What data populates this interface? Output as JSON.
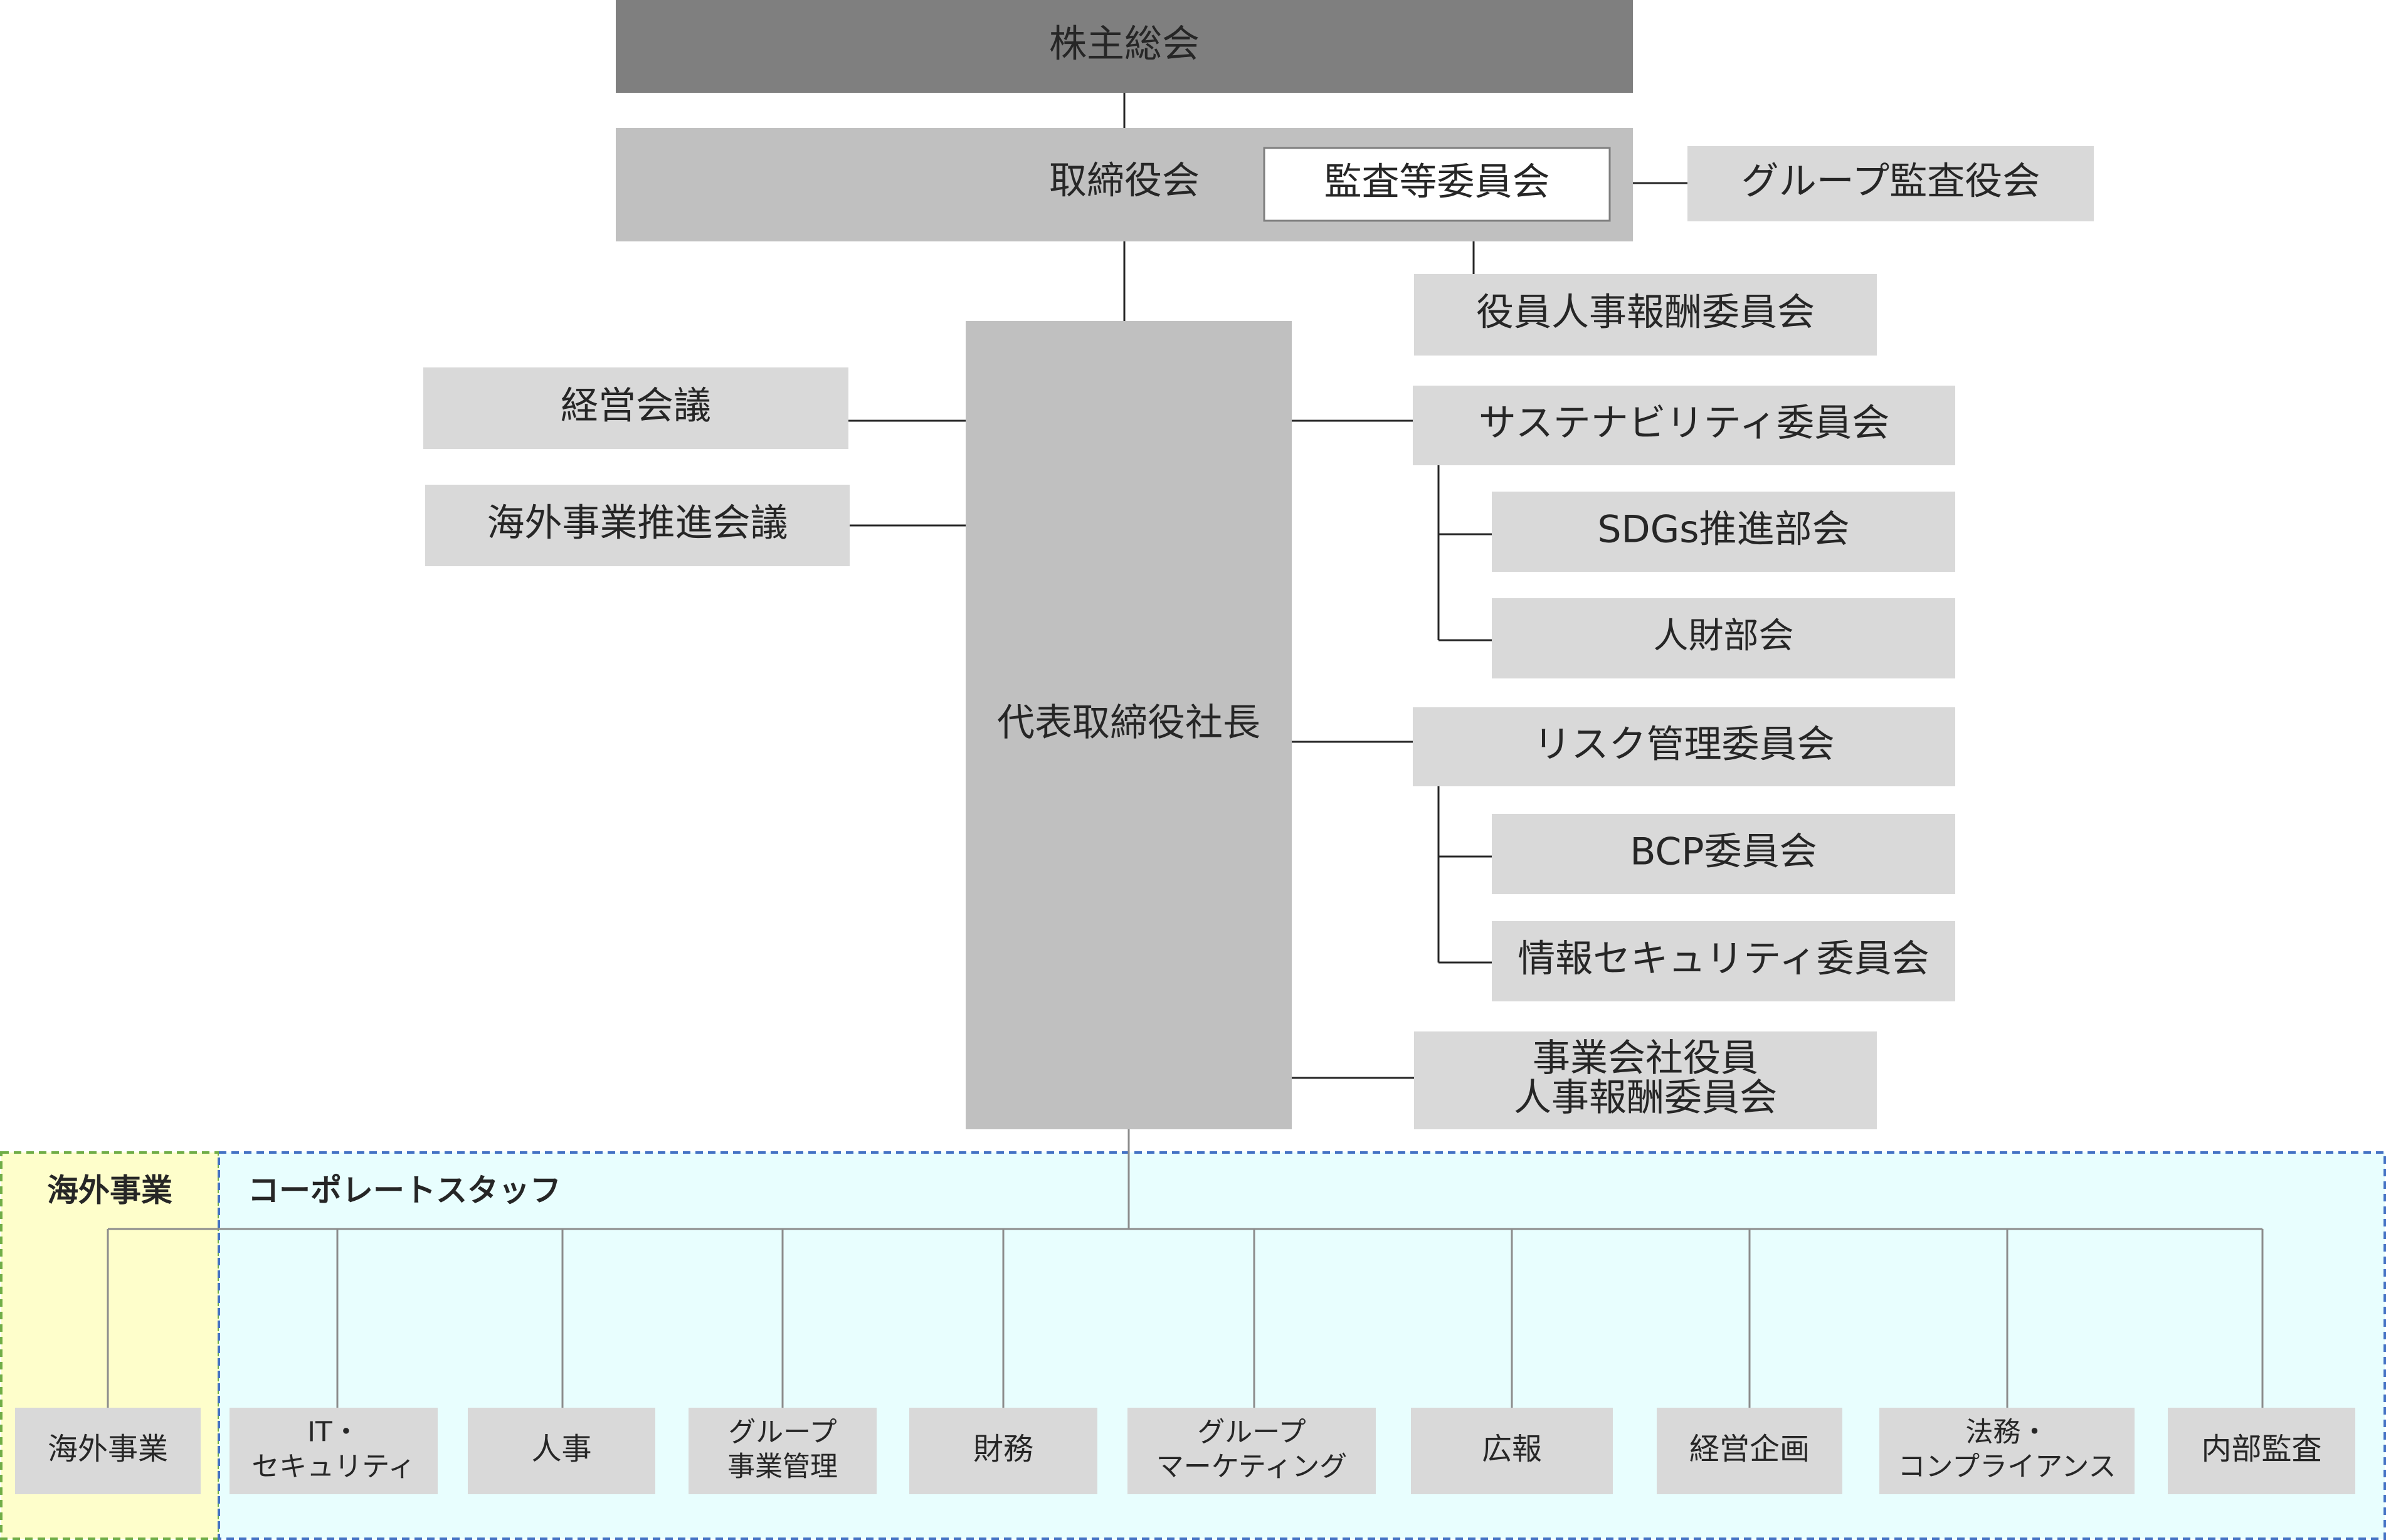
{
  "colors": {
    "dark_box": "#7f7f7f",
    "light_box": "#c0c0c0",
    "pale_box": "#d9d9d9",
    "line": "#262626",
    "staff_line": "#8c8c8c",
    "overseas_fill": "#fefecb",
    "overseas_border": "#70ad47",
    "overseas_label": "#548235",
    "corporate_fill": "#e8fefe",
    "corporate_border": "#4472c4",
    "corporate_label": "#2e75b6"
  },
  "governance": {
    "shareholders": "株主総会",
    "board": "取締役会",
    "audit_committee": "監査等委員会",
    "group_audit": "グループ監査役会",
    "officer_comp": "役員人事報酬委員会",
    "president": "代表取締役社長"
  },
  "left_meetings": [
    "経営会議",
    "海外事業推進会議"
  ],
  "committees": {
    "sustainability": "サステナビリティ委員会",
    "sdgs": "SDGs推進部会",
    "hr_sub": "人財部会",
    "risk": "リスク管理委員会",
    "bcp": "BCP委員会",
    "infosec": "情報セキュリティ委員会",
    "subsidiary_comp": [
      "事業会社役員",
      "人事報酬委員会"
    ]
  },
  "regions": {
    "overseas_label": "海外事業",
    "corporate_label": "コーポレートスタッフ"
  },
  "departments": [
    [
      "海外事業"
    ],
    [
      "IT・",
      "セキュリティ"
    ],
    [
      "人事"
    ],
    [
      "グループ",
      "事業管理"
    ],
    [
      "財務"
    ],
    [
      "グループ",
      "マーケティング"
    ],
    [
      "広報"
    ],
    [
      "経営企画"
    ],
    [
      "法務・",
      "コンプライアンス"
    ],
    [
      "内部監査"
    ]
  ]
}
